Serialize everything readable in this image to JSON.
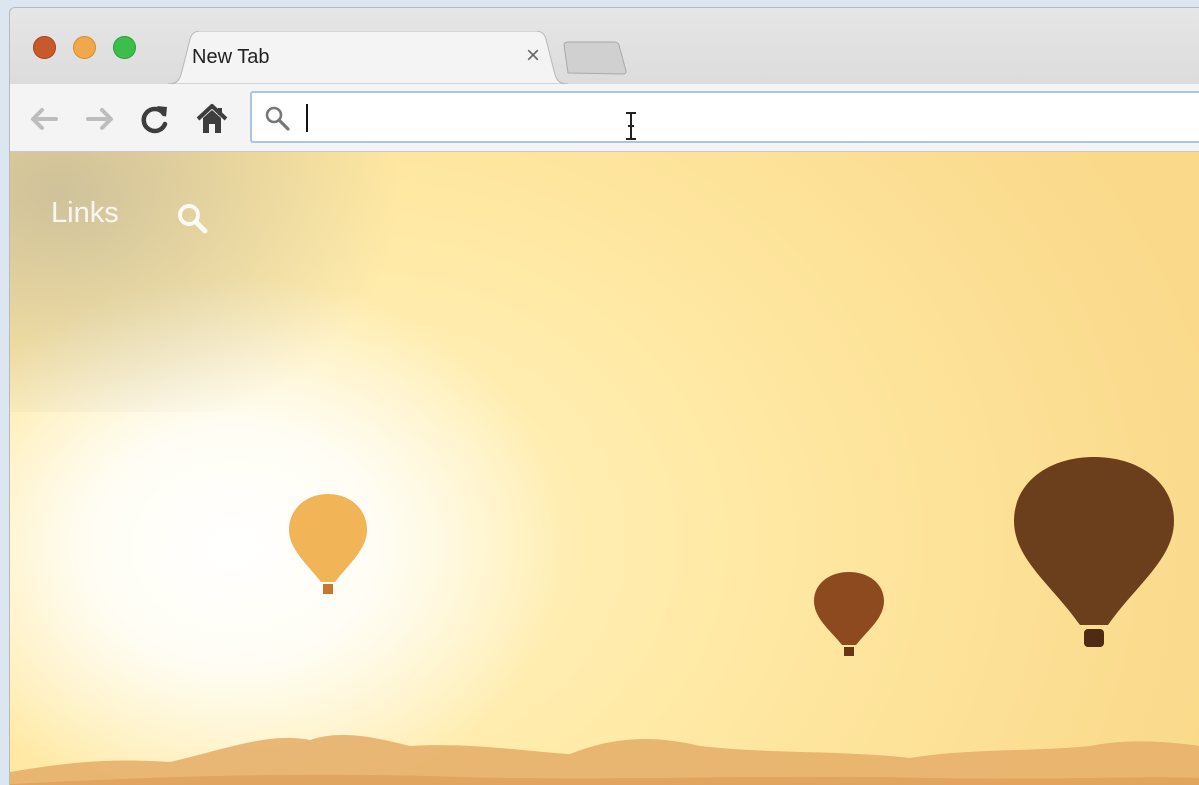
{
  "browser": {
    "tab": {
      "title": "New Tab",
      "close_glyph": "×"
    },
    "traffic_lights": {
      "close_color": "#c65a2c",
      "minimize_color": "#f0a84a",
      "maximize_color": "#3dbd4c"
    },
    "toolbar": {
      "back_icon": "arrow-left-icon",
      "forward_icon": "arrow-right-icon",
      "reload_icon": "reload-icon",
      "home_icon": "home-icon"
    },
    "omnibox": {
      "value": "",
      "placeholder": "",
      "icon": "search-icon"
    }
  },
  "page": {
    "links_label": "Links",
    "search_icon": "search-icon",
    "background": {
      "sky_color": "#fbd98c",
      "balloon_colors": [
        "#f1b457",
        "#8e4a1f",
        "#6b3f1c"
      ]
    }
  }
}
